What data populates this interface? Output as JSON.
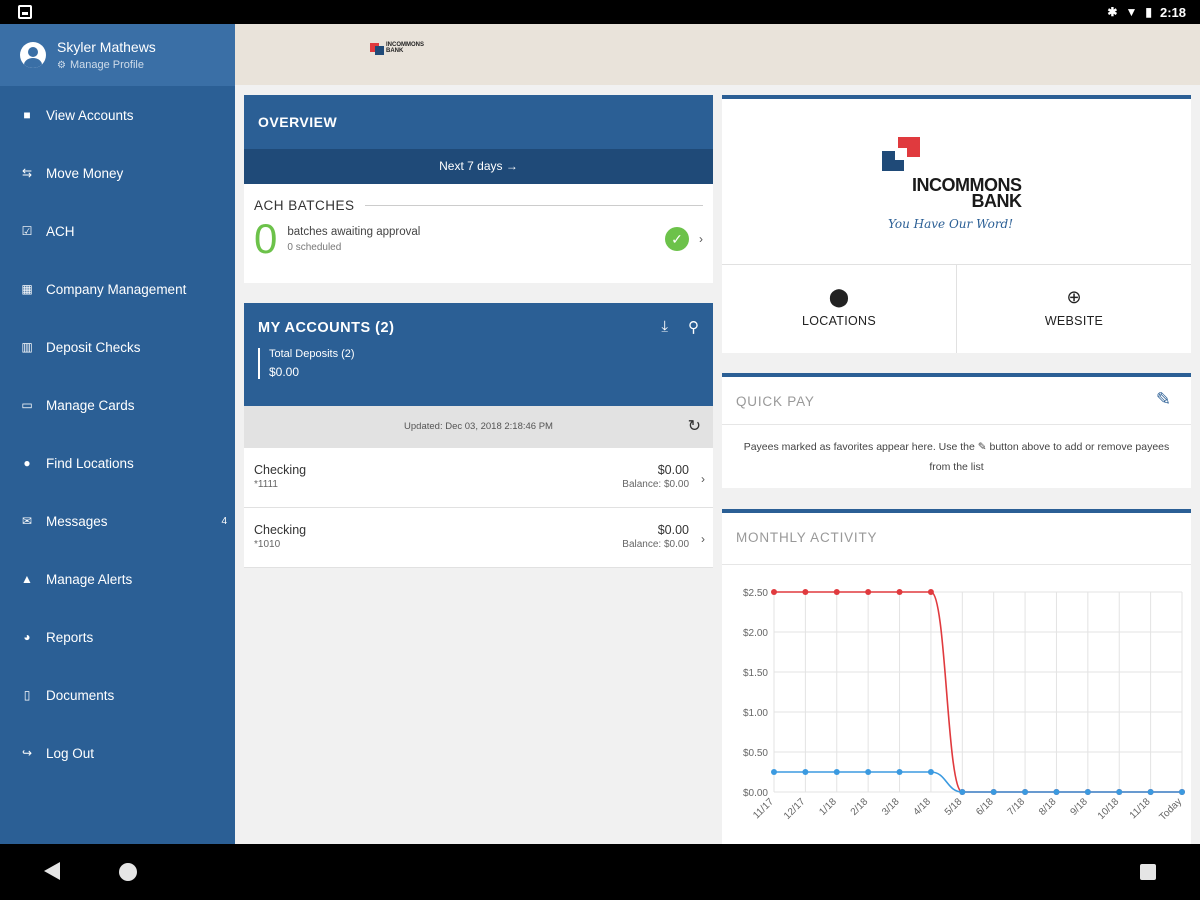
{
  "status": {
    "time": "2:18"
  },
  "profile": {
    "name": "Skyler Mathews",
    "manage_label": "Manage Profile"
  },
  "sidebar": {
    "items": [
      {
        "label": "View Accounts",
        "icon": "■"
      },
      {
        "label": "Move Money",
        "icon": "⇆"
      },
      {
        "label": "ACH",
        "icon": "☑"
      },
      {
        "label": "Company Management",
        "icon": "▦"
      },
      {
        "label": "Deposit Checks",
        "icon": "▥"
      },
      {
        "label": "Manage Cards",
        "icon": "▭"
      },
      {
        "label": "Find Locations",
        "icon": "●"
      },
      {
        "label": "Messages",
        "icon": "✉",
        "badge": "4"
      },
      {
        "label": "Manage Alerts",
        "icon": "▲"
      },
      {
        "label": "Reports",
        "icon": "◕"
      },
      {
        "label": "Documents",
        "icon": "▯"
      },
      {
        "label": "Log Out",
        "icon": "↪"
      }
    ]
  },
  "header": {
    "logo_text_line1": "INCOMMONS",
    "logo_text_line2": "BANK"
  },
  "overview": {
    "title": "OVERVIEW",
    "next_label": "Next 7 days →",
    "ach_title": "ACH BATCHES",
    "ach_count": "0",
    "ach_text": "batches awaiting approval",
    "ach_sub": "0 scheduled"
  },
  "accounts": {
    "title": "MY ACCOUNTS (2)",
    "total_label": "Total Deposits (2)",
    "total_value": "$0.00",
    "updated": "Updated: Dec 03, 2018 2:18:46 PM",
    "rows": [
      {
        "name": "Checking",
        "number": "*1111",
        "amount": "$0.00",
        "balance": "Balance: $0.00"
      },
      {
        "name": "Checking",
        "number": "*1010",
        "amount": "$0.00",
        "balance": "Balance: $0.00"
      }
    ]
  },
  "brand": {
    "name_line1": "INCOMMONS",
    "name_line2": "BANK",
    "tagline": "You Have Our Word!",
    "locations_label": "LOCATIONS",
    "website_label": "WEBSITE"
  },
  "quickpay": {
    "title": "QUICK PAY",
    "text": "Payees marked as favorites appear here. Use the ✎ button above to add or remove payees from the list"
  },
  "monthly": {
    "title": "MONTHLY ACTIVITY"
  },
  "colors": {
    "primary": "#2b5f95",
    "dark": "#1f4a78",
    "green": "#6cc24a",
    "red": "#e03a3e",
    "blue": "#3b9ae0"
  },
  "chart_data": {
    "type": "line",
    "x": [
      "11/17",
      "12/17",
      "1/18",
      "2/18",
      "3/18",
      "4/18",
      "5/18",
      "6/18",
      "7/18",
      "8/18",
      "9/18",
      "10/18",
      "11/18",
      "Today"
    ],
    "ylim": [
      0,
      2.5
    ],
    "yticks": [
      "$2.50",
      "$2.00",
      "$1.50",
      "$1.00",
      "$0.50",
      "$0.00"
    ],
    "grid": true,
    "series": [
      {
        "color": "#e03a3e",
        "values": [
          2.5,
          2.5,
          2.5,
          2.5,
          2.5,
          2.5,
          0,
          0,
          0,
          0,
          0,
          0,
          0,
          0
        ]
      },
      {
        "color": "#3b9ae0",
        "values": [
          0.25,
          0.25,
          0.25,
          0.25,
          0.25,
          0.25,
          0,
          0,
          0,
          0,
          0,
          0,
          0,
          0
        ]
      }
    ]
  }
}
